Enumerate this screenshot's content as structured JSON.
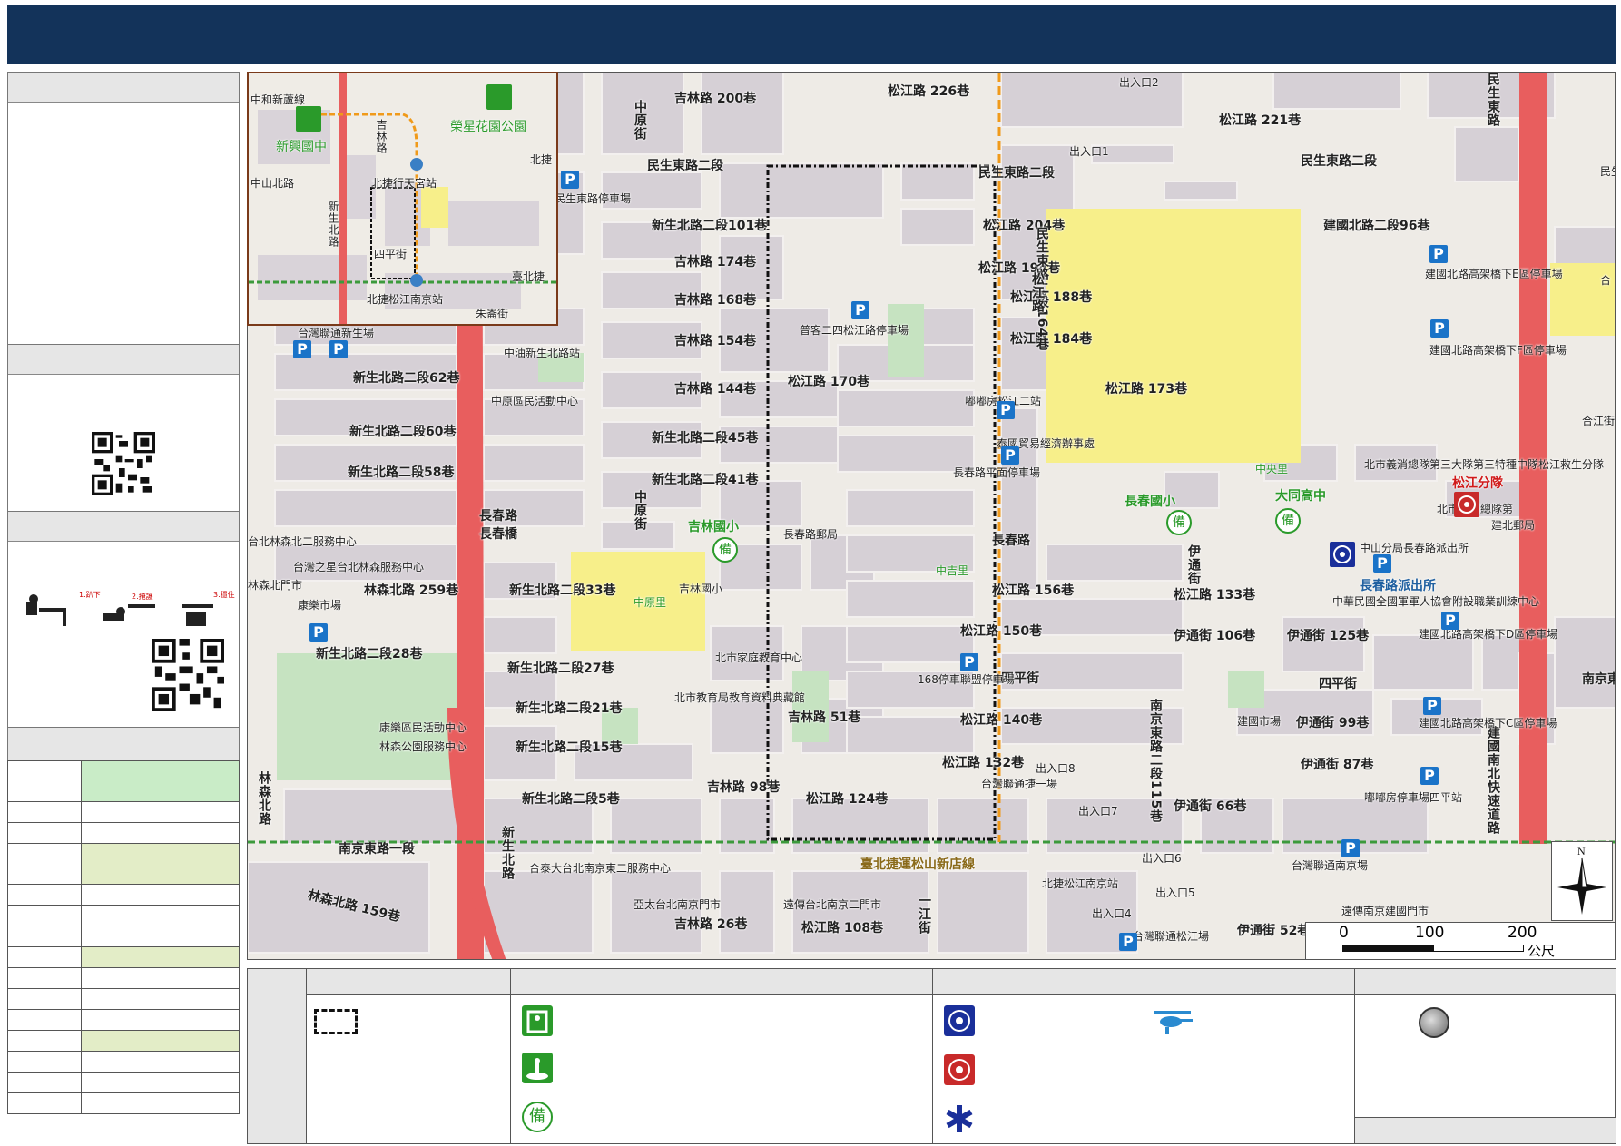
{
  "map": {
    "inset": {
      "labels": [
        "北捷行天宮站",
        "北捷松江南京站",
        "榮星花園公園",
        "新興國中",
        "中山北路",
        "中和新蘆線",
        "四平街",
        "朱崙街",
        "臺北捷",
        "吉林路",
        "新生北路",
        "北捷"
      ]
    },
    "roads": [
      "吉林路 200巷",
      "松江路 226巷",
      "出入口2",
      "出入口1",
      "松江路 221巷",
      "民生東路二段",
      "民生東路停車場",
      "新生北路二段101巷",
      "吉林路 174巷",
      "吉林路 168巷",
      "吉林路 154巷",
      "吉林路 144巷",
      "新生北路二段45巷",
      "新生北路二段41巷",
      "新生北路二段33巷",
      "新生北路二段27巷",
      "新生北路二段21巷",
      "新生北路二段15巷",
      "新生北路二段5巷",
      "新生北路二段62巷",
      "新生北路二段60巷",
      "新生北路二段58巷",
      "新生北路二段28巷",
      "松江路 204巷",
      "松江路 194巷",
      "松江路 188巷",
      "松江路 184巷",
      "松江路 170巷",
      "松江路 156巷",
      "松江路 150巷",
      "松江路 140巷",
      "松江路 132巷",
      "松江路 124巷",
      "松江路 133巷",
      "松江路 108巷",
      "松江路 173巷",
      "伊通街 106巷",
      "伊通街 125巷",
      "伊通街 99巷",
      "伊通街 87巷",
      "伊通街 66巷",
      "伊通街 52巷",
      "吉林路 51巷",
      "吉林路 98巷",
      "吉林路 26巷",
      "長春路",
      "長春橋",
      "四平街",
      "南京東路一段",
      "南京東路三段",
      "林森北路 259巷",
      "林森北路 159巷",
      "建國北路二段96巷",
      "民生東路二段164巷",
      "南京東路二段115巷",
      "建國南北快速道路",
      "長春路郵局",
      "台灣聯通新生場",
      "中油新生北路站",
      "中原區民活動中心",
      "普客二四松江路停車場",
      "嘟嘟房松江二站",
      "泰國貿易經濟辦事處",
      "長春路平面停車場",
      "168停車聯盟停車場",
      "台灣聯通捷一場",
      "出入口8",
      "出入口7",
      "出入口6",
      "出入口5",
      "出入口4",
      "北捷松江南京站",
      "台灣聯通南京場",
      "遠傳南京建國門市",
      "亞太台北南京門市",
      "遠傳台北南京二門市",
      "台灣聯通松江場",
      "北市教育局教育資料典藏館",
      "北市家庭教育中心",
      "吉林國小",
      "中原里",
      "中吉里",
      "中央里",
      "長春國小",
      "大同高中",
      "松江分隊",
      "北市義消總隊第三大隊第三特種中隊松江救生分隊",
      "北市義消總隊第",
      "中山分局長春路派出所",
      "長春路派出所",
      "建國北路高架橋下E區停車場",
      "建國北路高架橋下F區停車場",
      "建國北路高架橋下D區停車場",
      "建國北路高架橋下C區停車場",
      "嘟嘟房停車場四平站",
      "中華民國全國軍軍人協會附設職業訓練中心",
      "建國市場",
      "康樂市場",
      "康樂區民活動中心",
      "林森公園服務中心",
      "台北林森北二服務中心",
      "台灣之星台北林森服務中心",
      "林森北門市",
      "合泰大台北南京東二服務中心",
      "臺北捷運松山新店線",
      "長春路",
      "建北郵局",
      "合江街",
      "民生",
      "合",
      "新生北路",
      "林森北路",
      "中原街",
      "伊通街",
      "民生東路",
      "一江街",
      "松江路"
    ],
    "scale": {
      "ticks": [
        "0",
        "100",
        "200"
      ],
      "unit": "公尺"
    },
    "compass": {
      "north": "N"
    }
  },
  "legend": {
    "icons": [
      "boundary-dashed",
      "shelter-icon",
      "park-icon",
      "reserve-icon",
      "police-icon",
      "fire-icon",
      "medical-icon",
      "helicopter-icon",
      "metro-station-icon"
    ]
  },
  "colors": {
    "header": "#13335a",
    "school_zone": "#f7ef8a",
    "park": "#c6e3c1",
    "main_road": "#e85e5e",
    "block": "#d9d3d9",
    "metro_line": "#3c9a3c",
    "parking": "#1a73c8"
  }
}
